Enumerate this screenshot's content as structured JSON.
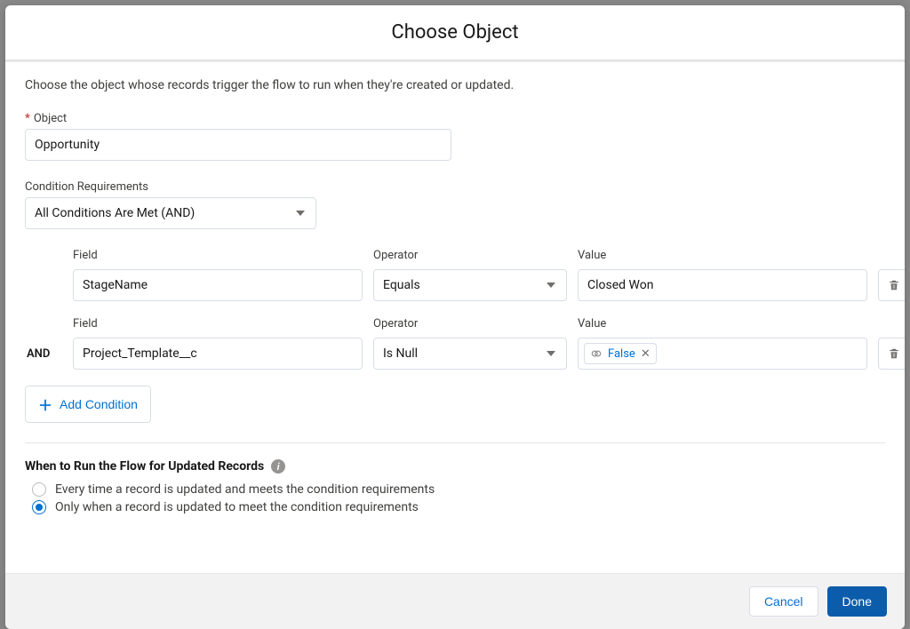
{
  "modal": {
    "title": "Choose Object",
    "intro": "Choose the object whose records trigger the flow to run when they're created or updated."
  },
  "object": {
    "label": "Object",
    "value": "Opportunity"
  },
  "conditionRequirements": {
    "label": "Condition Requirements",
    "value": "All Conditions Are Met (AND)"
  },
  "condHeaders": {
    "field": "Field",
    "operator": "Operator",
    "value": "Value"
  },
  "logic": {
    "and": "AND"
  },
  "conditions": [
    {
      "field": "StageName",
      "operator": "Equals",
      "valueType": "text",
      "value": "Closed Won"
    },
    {
      "field": "Project_Template__c",
      "operator": "Is Null",
      "valueType": "pill",
      "value": "False"
    }
  ],
  "addCondition": "Add Condition",
  "whenToRun": {
    "heading": "When to Run the Flow for Updated Records",
    "options": [
      "Every time a record is updated and meets the condition requirements",
      "Only when a record is updated to meet the condition requirements"
    ],
    "selected": 1
  },
  "footer": {
    "cancel": "Cancel",
    "done": "Done"
  }
}
